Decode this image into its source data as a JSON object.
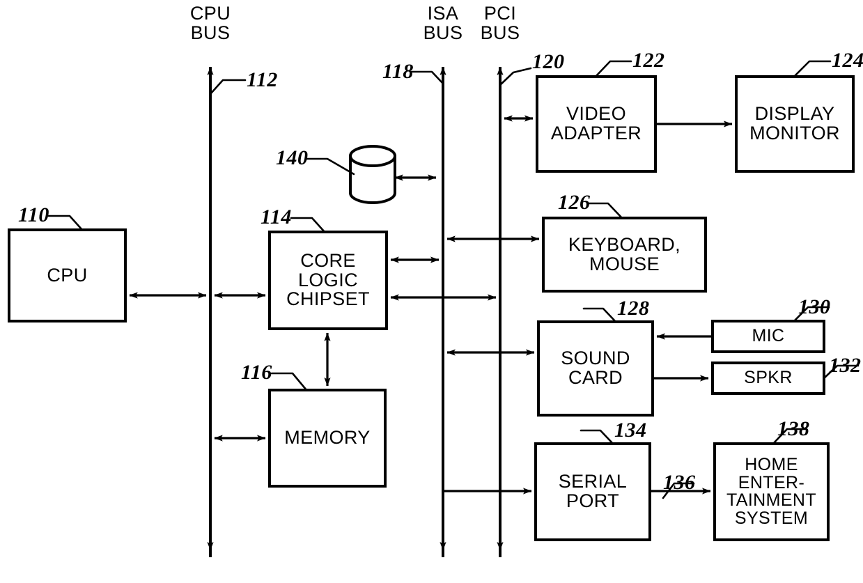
{
  "figure": {
    "kind": "patent-block-diagram",
    "title": "Computer system block diagram",
    "ink_color": "#000000",
    "background_color": "#ffffff"
  },
  "buses": [
    {
      "id": "cpu-bus",
      "label": "CPU\nBUS",
      "ref": "112"
    },
    {
      "id": "isa-bus",
      "label": "ISA\nBUS",
      "ref": "118"
    },
    {
      "id": "pci-bus",
      "label": "PCI\nBUS",
      "ref": "120"
    }
  ],
  "blocks": [
    {
      "id": "cpu",
      "label": "CPU",
      "ref": "110"
    },
    {
      "id": "core-logic",
      "label": "CORE\nLOGIC\nCHIPSET",
      "ref": "114"
    },
    {
      "id": "memory",
      "label": "MEMORY",
      "ref": "116"
    },
    {
      "id": "video-adapter",
      "label": "VIDEO\nADAPTER",
      "ref": "122"
    },
    {
      "id": "display-monitor",
      "label": "DISPLAY\nMONITOR",
      "ref": "124"
    },
    {
      "id": "keyboard-mouse",
      "label": "KEYBOARD,\nMOUSE",
      "ref": "126"
    },
    {
      "id": "sound-card",
      "label": "SOUND\nCARD",
      "ref": "128"
    },
    {
      "id": "mic",
      "label": "MIC",
      "ref": "130"
    },
    {
      "id": "spkr",
      "label": "SPKR",
      "ref": "132"
    },
    {
      "id": "serial-port",
      "label": "SERIAL\nPORT",
      "ref": "134"
    },
    {
      "id": "home-ent",
      "label": "HOME\nENTER-\nTAINMENT\nSYSTEM",
      "ref": "138"
    },
    {
      "id": "disk-drive",
      "label": "",
      "ref": "140"
    }
  ],
  "connections": [
    {
      "id": "serial-to-home",
      "ref": "136"
    }
  ],
  "labels": {
    "cpu_bus": "CPU\nBUS",
    "isa_bus": "ISA\nBUS",
    "pci_bus": "PCI\nBUS",
    "cpu": "CPU",
    "core_logic": "CORE\nLOGIC\nCHIPSET",
    "memory": "MEMORY",
    "video_adapter": "VIDEO\nADAPTER",
    "display_monitor": "DISPLAY\nMONITOR",
    "keyboard_mouse": "KEYBOARD,\nMOUSE",
    "sound_card": "SOUND\nCARD",
    "mic": "MIC",
    "spkr": "SPKR",
    "serial_port": "SERIAL\nPORT",
    "home_entertainment": "HOME\nENTER-\nTAINMENT\nSYSTEM"
  },
  "refs": {
    "r110": "110",
    "r112": "112",
    "r114": "114",
    "r116": "116",
    "r118": "118",
    "r120": "120",
    "r122": "122",
    "r124": "124",
    "r126": "126",
    "r128": "128",
    "r130": "130",
    "r132": "132",
    "r134": "134",
    "r136": "136",
    "r138": "138",
    "r140": "140"
  }
}
